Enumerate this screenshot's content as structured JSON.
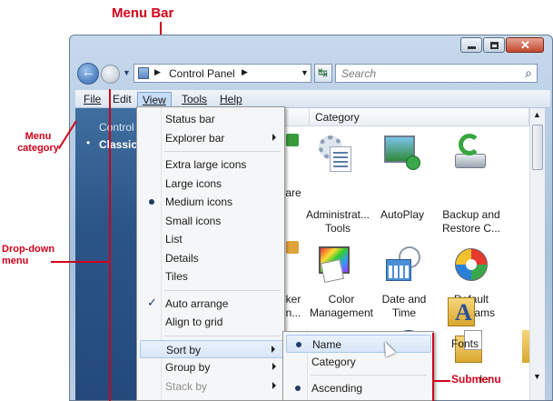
{
  "annotations": {
    "menu_bar": "Menu Bar",
    "menu_category": "Menu\ncategory",
    "dropdown_menu": "Drop-down\nmenu",
    "submenu": "Submenu"
  },
  "window": {
    "breadcrumb": "Control Panel",
    "search_placeholder": "Search",
    "menus": [
      "File",
      "Edit",
      "View",
      "Tools",
      "Help"
    ],
    "left_pane": {
      "title": "Control",
      "bullet_item": "Classic V"
    },
    "column_header": "Category",
    "icons": [
      {
        "label": "Administrat...\nTools",
        "icon": "admin-tools-icon"
      },
      {
        "label": "AutoPlay",
        "icon": "autoplay-icon"
      },
      {
        "label": "Backup and\nRestore C...",
        "icon": "backup-icon"
      },
      {
        "label": "Color\nManagement",
        "icon": "color-management-icon"
      },
      {
        "label": "Date and\nTime",
        "icon": "date-time-icon"
      },
      {
        "label": "Default\nPrograms",
        "icon": "default-programs-icon"
      },
      {
        "label": "",
        "icon": "ease-of-access-icon"
      },
      {
        "label": "ler",
        "icon": "folder-options-icon"
      },
      {
        "label": "Fonts",
        "icon": "fonts-icon"
      }
    ],
    "partial_labels": [
      "are",
      "ker",
      "n..."
    ]
  },
  "view_menu": {
    "items": [
      {
        "label": "Status bar"
      },
      {
        "label": "Explorer bar",
        "submenu": true
      },
      {
        "sep": true
      },
      {
        "label": "Extra large icons"
      },
      {
        "label": "Large icons"
      },
      {
        "label": "Medium icons",
        "bullet": true
      },
      {
        "label": "Small icons"
      },
      {
        "label": "List"
      },
      {
        "label": "Details"
      },
      {
        "label": "Tiles"
      },
      {
        "sep": true
      },
      {
        "label": "Auto arrange",
        "check": true
      },
      {
        "label": "Align to grid"
      },
      {
        "sep": true
      },
      {
        "label": "Sort by",
        "submenu": true,
        "highlight": true
      },
      {
        "label": "Group by",
        "submenu": true
      },
      {
        "label": "Stack by",
        "submenu": true,
        "disabled": true
      }
    ]
  },
  "sort_submenu": {
    "items": [
      {
        "label": "Name",
        "bullet": true,
        "highlight": true
      },
      {
        "label": "Category"
      },
      {
        "sep": true
      },
      {
        "label": "Ascending",
        "bullet": true
      }
    ]
  },
  "colors": {
    "callout_red": "#d0021b",
    "menu_highlight": "#d7e6f7",
    "sidebar_blue": "#2c5587"
  }
}
